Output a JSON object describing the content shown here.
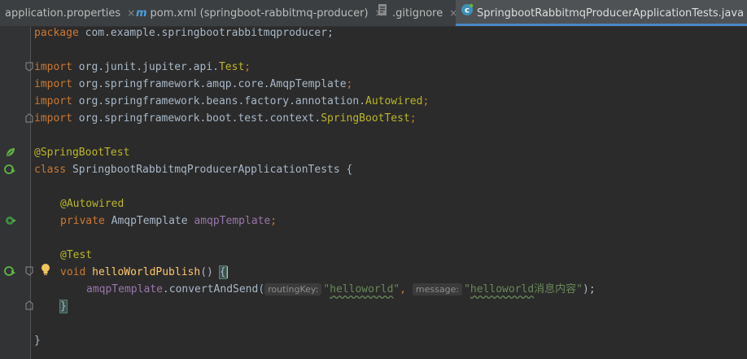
{
  "tabs": [
    {
      "label": "application.properties",
      "icon": "properties-file-icon",
      "active": false
    },
    {
      "label": "pom.xml (springboot-rabbitmq-producer)",
      "icon": "maven-icon",
      "active": false
    },
    {
      "label": ".gitignore",
      "icon": "gitignore-file-icon",
      "active": false
    },
    {
      "label": "SpringbootRabbitmqProducerApplicationTests.java",
      "icon": "java-class-icon",
      "active": true
    }
  ],
  "tab_close_glyph": "×",
  "maven_glyph": "m",
  "code": {
    "package_kw": "package",
    "package_name": " com.example.springbootrabbitmqproducer;",
    "import_kw": "import",
    "imports": [
      {
        "prefix": " org.junit.jupiter.api.",
        "name": "Test",
        "suffix": ";"
      },
      {
        "prefix": " org.springframework.amqp.core.",
        "name": "AmqpTemplate",
        "suffix": ";"
      },
      {
        "prefix": " org.springframework.beans.factory.annotation.",
        "name": "Autowired",
        "suffix": ";"
      },
      {
        "prefix": " org.springframework.boot.test.context.",
        "name": "SpringBootTest",
        "suffix": ";"
      }
    ],
    "class_annotation": "@SpringBootTest",
    "class_kw": "class",
    "class_name": " SpringbootRabbitmqProducerApplicationTests {",
    "field_annotation": "@Autowired",
    "private_kw": "private",
    "field_type": " AmqpTemplate ",
    "field_name": "amqpTemplate",
    "semicolon": ";",
    "method_annotation": "@Test",
    "void_kw": "void",
    "method_name": "helloWorldPublish",
    "method_parens": "() ",
    "open_brace": "{",
    "call_target": "amqpTemplate",
    "call_method": ".convertAndSend(",
    "hint_routing_key": "routingKey:",
    "arg1_q1": "\"",
    "arg1_word": "helloworld",
    "arg1_q2": "\"",
    "comma": ", ",
    "hint_message": "message:",
    "arg2_q1": "\"",
    "arg2_word": "helloworld",
    "arg2_rest": "消息内容\"",
    "call_end": ");",
    "close_brace_method": "}",
    "close_brace_class": "}"
  },
  "colors": {
    "keyword": "#cc7832",
    "annotation": "#bbb529",
    "string": "#6a8759",
    "field": "#9876aa",
    "method": "#ffc66d",
    "plain": "#a9b7c6",
    "active_tab_underline": "#4a88c7"
  }
}
